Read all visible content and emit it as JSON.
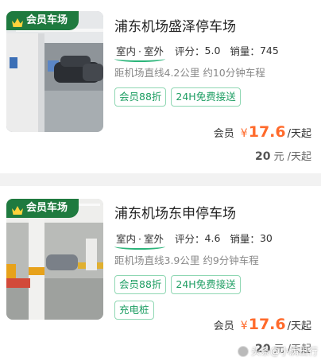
{
  "listings": [
    {
      "badge": "会员车场",
      "title": "浦东机场盛泽停车场",
      "indoor": "室内",
      "outdoor": "室外",
      "rating_label": "评分：",
      "rating": "5.0",
      "sales_label": "销量：",
      "sales": "745",
      "distance": "距机场直线4.2公里 约10分钟车程",
      "tags": [
        "会员88折",
        "24H免费接送"
      ],
      "member_label": "会员",
      "currency": "¥",
      "member_price": "17.6",
      "unit": "/天起",
      "original_price": "20",
      "original_unit": "元 /天起"
    },
    {
      "badge": "会员车场",
      "title": "浦东机场东申停车场",
      "indoor": "室内",
      "outdoor": "室外",
      "rating_label": "评分：",
      "rating": "4.6",
      "sales_label": "销量：",
      "sales": "30",
      "distance": "距机场直线3.9公里 约9分钟车程",
      "tags": [
        "会员88折",
        "24H免费接送",
        "充电桩"
      ],
      "member_label": "会员",
      "currency": "¥",
      "member_price": "17.6",
      "unit": "/天起",
      "original_price": "20",
      "original_unit": "元 /天起"
    }
  ],
  "watermark": "头条@小满出行",
  "colors": {
    "badge_bg": "#1f7a3f",
    "tag_text": "#1e9e63",
    "tag_border": "#8fd7b3",
    "price": "#ff6a2b",
    "separator": "#f2f2f2"
  },
  "icons": {
    "badge": "crown-icon",
    "watermark": "toutiao-logo-icon"
  }
}
